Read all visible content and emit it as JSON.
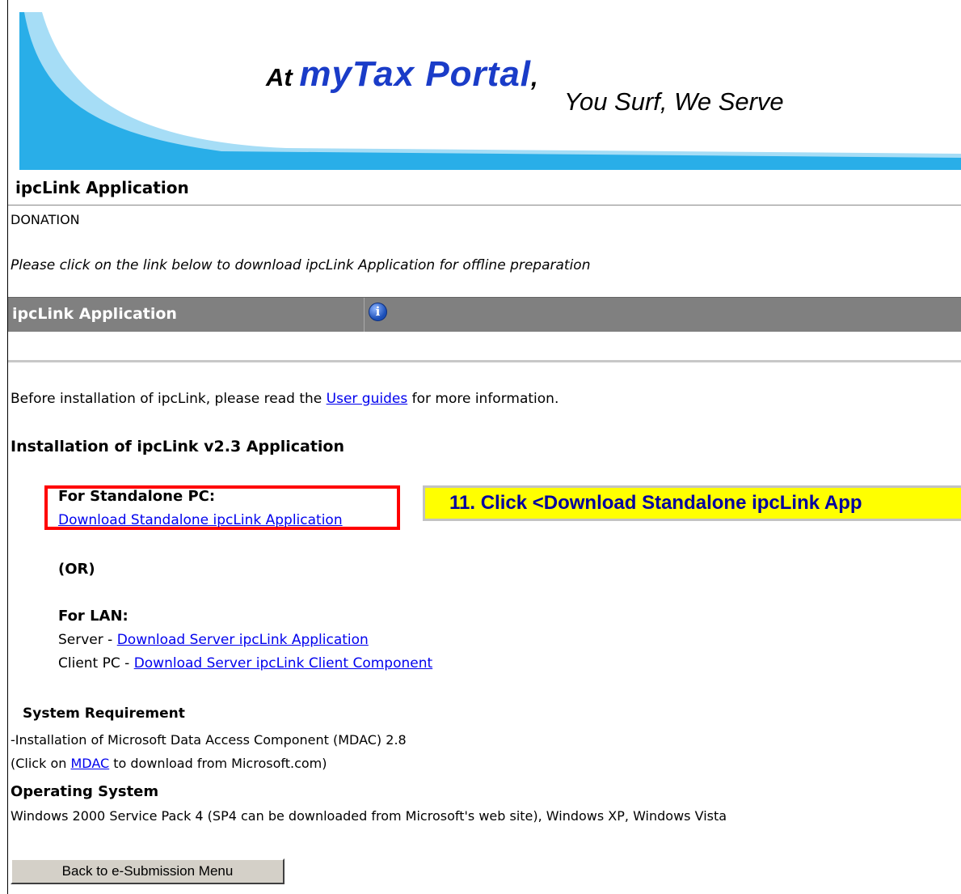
{
  "banner": {
    "brand_prefix": "At ",
    "brand_name": "myTax Portal",
    "brand_comma": ",",
    "tagline": "You Surf, We Serve"
  },
  "page": {
    "title": "ipcLink Application",
    "category": "DONATION",
    "instruction": "Please click on the link below to download ipcLink Application for offline preparation"
  },
  "grid": {
    "header": "ipcLink Application",
    "info_icon": "i"
  },
  "note": {
    "before": "Before installation of ipcLink, please read the ",
    "link": "User guides",
    "after": " for more information."
  },
  "install": {
    "heading": "Installation of ipcLink v2.3 Application",
    "standalone_label": "For Standalone PC:",
    "standalone_link": "Download Standalone ipcLink Application",
    "or": "(OR)",
    "lan_label": "For LAN:",
    "server_prefix": "Server - ",
    "server_link": "Download Server ipcLink Application",
    "client_prefix": "Client PC - ",
    "client_link": "Download Server ipcLink Client Component"
  },
  "callout": {
    "text": "11.    Click <Download Standalone ipcLink App"
  },
  "system": {
    "heading": "System Requirement",
    "req1": "-Installation of Microsoft Data Access Component (MDAC) 2.8",
    "req2_before": "(Click on ",
    "req2_link": "MDAC",
    "req2_after": " to download from Microsoft.com)",
    "os_heading": "Operating System",
    "os_value": "Windows 2000 Service Pack 4 (SP4 can be downloaded from Microsoft's web site), Windows XP, Windows Vista"
  },
  "buttons": {
    "back": "Back to e-Submission Menu"
  },
  "colors": {
    "link": "#0000ee",
    "callout_bg": "#ffff00",
    "callout_text": "#0000a0",
    "highlight_border": "#ff0000",
    "grid_header": "#808080",
    "brand_blue": "#1a3cc8"
  }
}
